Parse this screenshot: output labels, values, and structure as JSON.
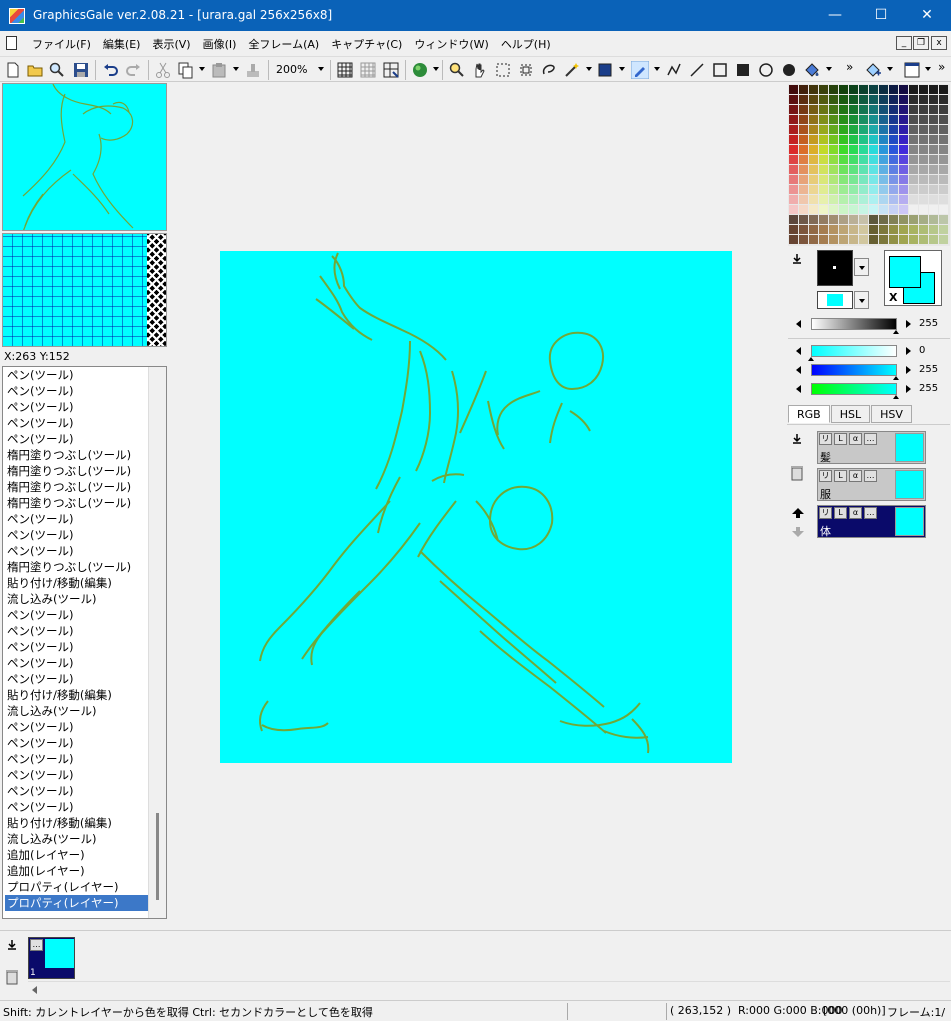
{
  "window": {
    "title": "GraphicsGale ver.2.08.21 - [urara.gal 256x256x8]",
    "minimize": "—",
    "maximize": "☐",
    "close": "✕"
  },
  "menu": [
    "ファイル(F)",
    "編集(E)",
    "表示(V)",
    "画像(I)",
    "全フレーム(A)",
    "キャプチャ(C)",
    "ウィンドウ(W)",
    "ヘルプ(H)"
  ],
  "mdi": {
    "minimize": "_",
    "restore": "❐",
    "close": "x"
  },
  "toolbar": {
    "zoom": "200%",
    "overflow": "»"
  },
  "coords": "X:263 Y:152",
  "history": [
    "ペン(ツール)",
    "ペン(ツール)",
    "ペン(ツール)",
    "ペン(ツール)",
    "ペン(ツール)",
    "楕円塗りつぶし(ツール)",
    "楕円塗りつぶし(ツール)",
    "楕円塗りつぶし(ツール)",
    "楕円塗りつぶし(ツール)",
    "ペン(ツール)",
    "ペン(ツール)",
    "ペン(ツール)",
    "楕円塗りつぶし(ツール)",
    "貼り付け/移動(編集)",
    "流し込み(ツール)",
    "ペン(ツール)",
    "ペン(ツール)",
    "ペン(ツール)",
    "ペン(ツール)",
    "ペン(ツール)",
    "貼り付け/移動(編集)",
    "流し込み(ツール)",
    "ペン(ツール)",
    "ペン(ツール)",
    "ペン(ツール)",
    "ペン(ツール)",
    "ペン(ツール)",
    "ペン(ツール)",
    "貼り付け/移動(編集)",
    "流し込み(ツール)",
    "追加(レイヤー)",
    "追加(レイヤー)",
    "プロパティ(レイヤー)",
    "プロパティ(レイヤー)"
  ],
  "history_selected": 33,
  "sliders": {
    "gray": "255",
    "red": "0",
    "green": "255",
    "blue": "255"
  },
  "color_tabs": [
    "RGB",
    "HSL",
    "HSV"
  ],
  "fgbg_label": "X",
  "layers": [
    {
      "name": "髪",
      "selected": false
    },
    {
      "name": "服",
      "selected": false
    },
    {
      "name": "体",
      "selected": true
    }
  ],
  "layer_flags": [
    "リ",
    "L",
    "α",
    "…"
  ],
  "frame": {
    "number": "1"
  },
  "status": {
    "hint": "Shift: カレントレイヤーから色を取得  Ctrl: セカンドカラーとして色を取得",
    "pos": "( 263,152 )",
    "rgb": "R:000 G:000 B:000",
    "index": "[000 (00h)]",
    "frame": "フレーム:1/"
  },
  "colors": {
    "canvas": "#00ffff",
    "line": "#70a838",
    "titlebar": "#0a62b8",
    "selected_layer": "#0a0a6a"
  }
}
